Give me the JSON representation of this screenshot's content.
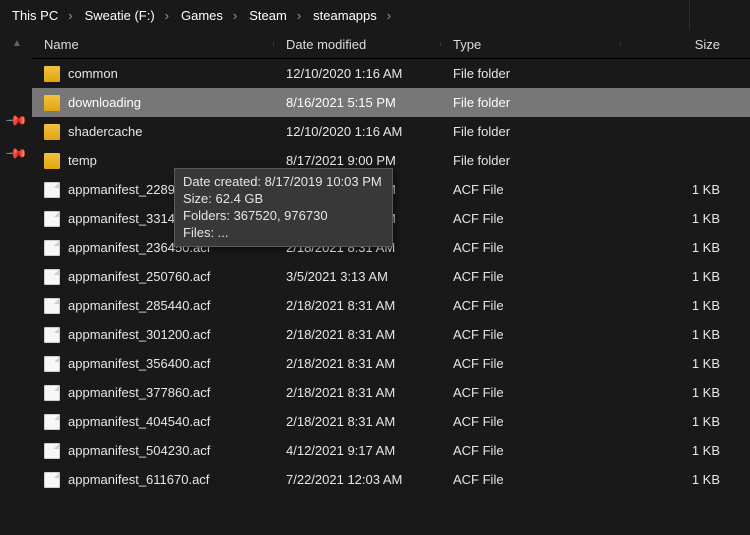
{
  "breadcrumb": [
    "This PC",
    "Sweatie (F:)",
    "Games",
    "Steam",
    "steamapps"
  ],
  "columns": {
    "name": "Name",
    "date": "Date modified",
    "type": "Type",
    "size": "Size"
  },
  "rows": [
    {
      "icon": "folder",
      "name": "common",
      "date": "12/10/2020 1:16 AM",
      "type": "File folder",
      "size": "",
      "selected": false
    },
    {
      "icon": "folder",
      "name": "downloading",
      "date": "8/16/2021 5:15 PM",
      "type": "File folder",
      "size": "",
      "selected": true
    },
    {
      "icon": "folder",
      "name": "shadercache",
      "date": "12/10/2020 1:16 AM",
      "type": "File folder",
      "size": "",
      "selected": false
    },
    {
      "icon": "folder",
      "name": "temp",
      "date": "8/17/2021 9:00 PM",
      "type": "File folder",
      "size": "",
      "selected": false
    },
    {
      "icon": "file",
      "name": "appmanifest_228980.acf",
      "date": "7/24/2021 3:22 PM",
      "type": "ACF File",
      "size": "1 KB",
      "selected": false
    },
    {
      "icon": "file",
      "name": "appmanifest_33140.acf",
      "date": "7/24/2021 3:22 PM",
      "type": "ACF File",
      "size": "1 KB",
      "selected": false
    },
    {
      "icon": "file",
      "name": "appmanifest_236450.acf",
      "date": "2/18/2021 8:31 AM",
      "type": "ACF File",
      "size": "1 KB",
      "selected": false
    },
    {
      "icon": "file",
      "name": "appmanifest_250760.acf",
      "date": "3/5/2021 3:13 AM",
      "type": "ACF File",
      "size": "1 KB",
      "selected": false
    },
    {
      "icon": "file",
      "name": "appmanifest_285440.acf",
      "date": "2/18/2021 8:31 AM",
      "type": "ACF File",
      "size": "1 KB",
      "selected": false
    },
    {
      "icon": "file",
      "name": "appmanifest_301200.acf",
      "date": "2/18/2021 8:31 AM",
      "type": "ACF File",
      "size": "1 KB",
      "selected": false
    },
    {
      "icon": "file",
      "name": "appmanifest_356400.acf",
      "date": "2/18/2021 8:31 AM",
      "type": "ACF File",
      "size": "1 KB",
      "selected": false
    },
    {
      "icon": "file",
      "name": "appmanifest_377860.acf",
      "date": "2/18/2021 8:31 AM",
      "type": "ACF File",
      "size": "1 KB",
      "selected": false
    },
    {
      "icon": "file",
      "name": "appmanifest_404540.acf",
      "date": "2/18/2021 8:31 AM",
      "type": "ACF File",
      "size": "1 KB",
      "selected": false
    },
    {
      "icon": "file",
      "name": "appmanifest_504230.acf",
      "date": "4/12/2021 9:17 AM",
      "type": "ACF File",
      "size": "1 KB",
      "selected": false
    },
    {
      "icon": "file",
      "name": "appmanifest_611670.acf",
      "date": "7/22/2021 12:03 AM",
      "type": "ACF File",
      "size": "1 KB",
      "selected": false
    }
  ],
  "tooltip": {
    "line1": "Date created: 8/17/2019 10:03 PM",
    "line2": "Size: 62.4 GB",
    "line3": "Folders: 367520, 976730",
    "line4": "Files: ..."
  }
}
